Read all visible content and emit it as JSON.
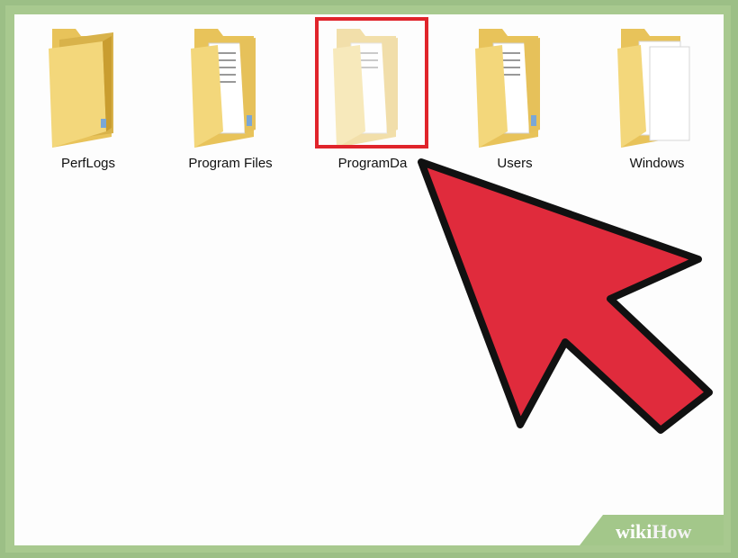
{
  "folders": [
    {
      "name": "PerfLogs",
      "icon": "folder-empty-icon"
    },
    {
      "name": "Program Files",
      "icon": "folder-documents-icon"
    },
    {
      "name": "ProgramDa",
      "icon": "folder-documents-icon",
      "hidden": true,
      "highlighted": true
    },
    {
      "name": "Users",
      "icon": "folder-documents-icon"
    },
    {
      "name": "Windows",
      "icon": "folder-pages-icon"
    }
  ],
  "annotation": {
    "color": "#e02b3c",
    "highlight_color": "#e0242b"
  },
  "watermark": {
    "part1": "wiki",
    "part2": "How"
  }
}
